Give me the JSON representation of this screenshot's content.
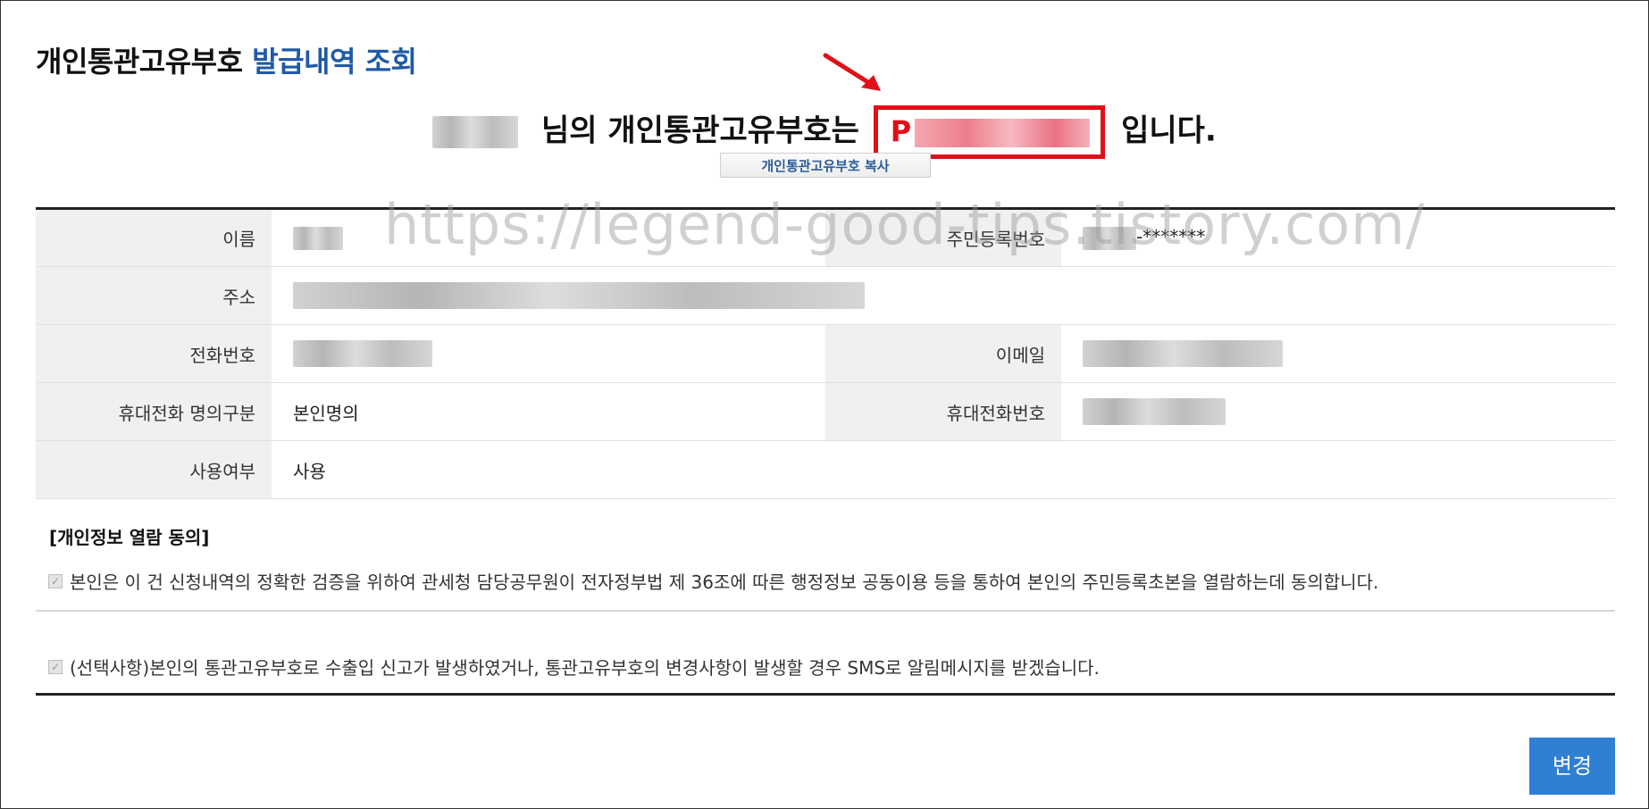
{
  "page": {
    "title_part1": "개인통관고유부호",
    "title_part2": "발급내역 조회"
  },
  "headline": {
    "suffix_name": "님의 개인통관고유부호는",
    "code_prefix": "P",
    "end": "입니다."
  },
  "copy_button_label": "개인통관고유부호 복사",
  "watermark": "https://legend-good-tips.tistory.com/",
  "table": {
    "name_label": "이름",
    "rrn_label": "주민등록번호",
    "rrn_masked_tail": "-*******",
    "address_label": "주소",
    "phone_label": "전화번호",
    "email_label": "이메일",
    "mobile_type_label": "휴대전화 명의구분",
    "mobile_type_value": "본인명의",
    "mobile_number_label": "휴대전화번호",
    "use_label": "사용여부",
    "use_value": "사용"
  },
  "consent": {
    "title": "[개인정보 열람 동의]",
    "item1": "본인은 이 건 신청내역의 정확한 검증을 위하여 관세청 담당공무원이 전자정부법 제 36조에 따른 행정정보 공동이용 등을 통하여 본인의 주민등록초본을 열람하는데 동의합니다.",
    "item2": "(선택사항)본인의 통관고유부호로 수출입 신고가 발생하였거나, 통관고유부호의 변경사항이 발생할 경우 SMS로 알림메시지를 받겠습니다.",
    "item1_checked": true,
    "item2_checked": true
  },
  "change_button_label": "변경",
  "colors": {
    "accent": "#1f5aa6",
    "highlight_red": "#e0101a",
    "primary_button": "#2f7fd5"
  }
}
